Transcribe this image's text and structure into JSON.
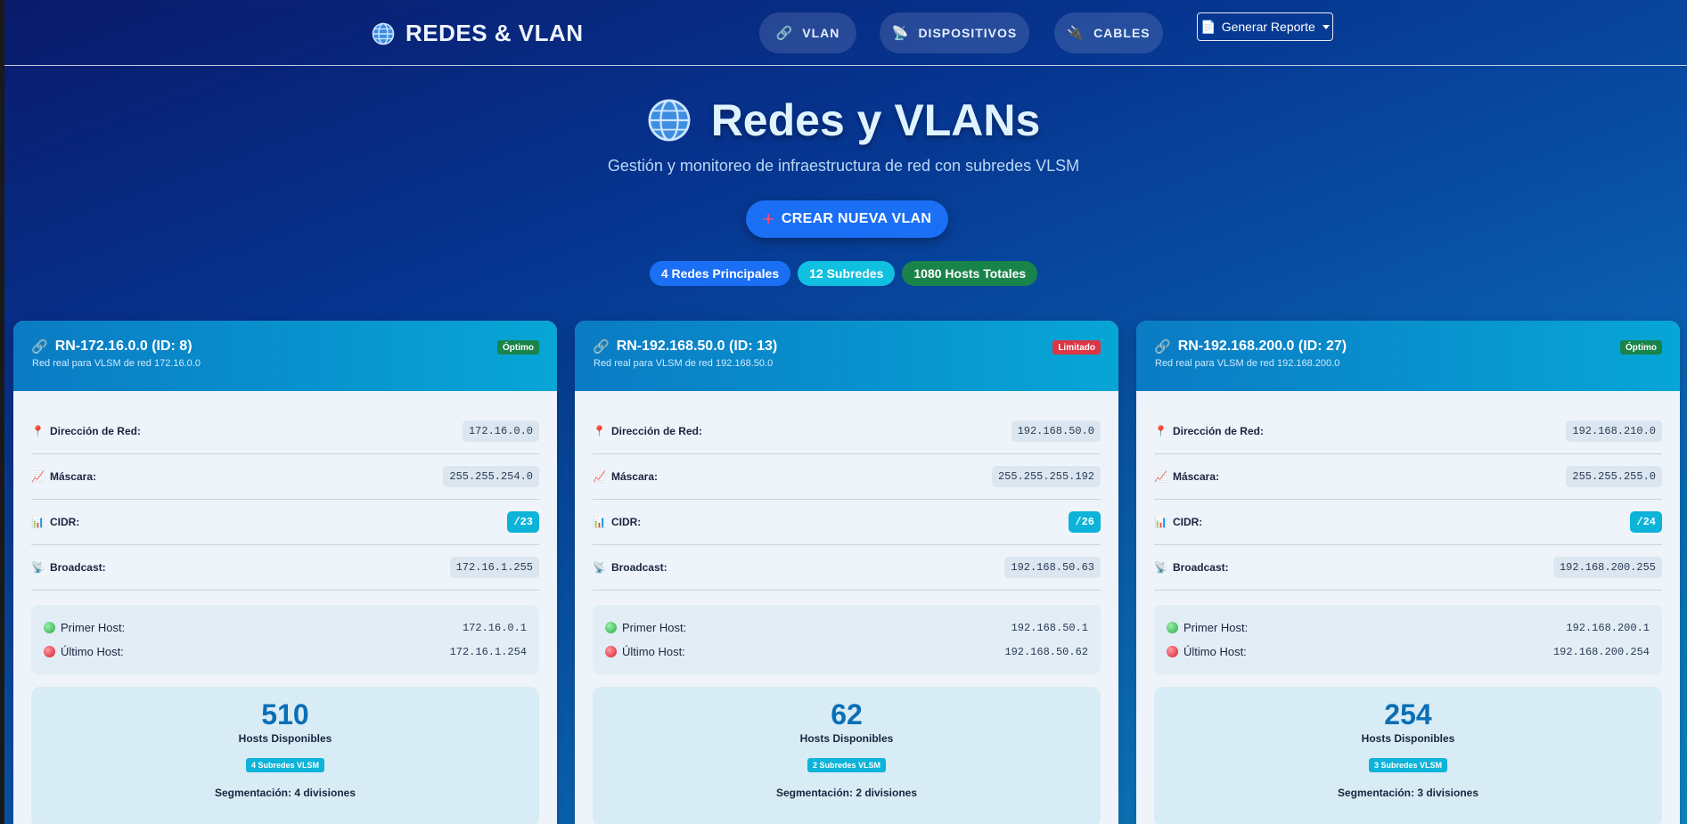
{
  "nav": {
    "brand": "REDES & VLAN",
    "links": [
      {
        "label": "VLAN",
        "icon": "link-icon"
      },
      {
        "label": "DISPOSITIVOS",
        "icon": "satellite-icon"
      },
      {
        "label": "CABLES",
        "icon": "cable-icon"
      }
    ],
    "report_label": "Generar Reporte"
  },
  "hero": {
    "title": "Redes y VLANs",
    "subtitle": "Gestión y monitoreo de infraestructura de red con subredes VLSM",
    "create_label": "CREAR NUEVA VLAN",
    "badges": [
      {
        "label": "4 Redes Principales",
        "color": "#1a6ff5"
      },
      {
        "label": "12 Subredes",
        "color": "#10c0e0"
      },
      {
        "label": "1080 Hosts Totales",
        "color": "#19844a"
      }
    ]
  },
  "labels": {
    "network": "Dirección de Red:",
    "mask": "Máscara:",
    "cidr": "CIDR:",
    "broadcast": "Broadcast:",
    "first_host": "Primer Host:",
    "last_host": "Último Host:",
    "hosts_available": "Hosts Disponibles"
  },
  "cards": [
    {
      "title": "RN-172.16.0.0 (ID: 8)",
      "description": "Red real para VLSM de red 172.16.0.0",
      "status": "Óptimo",
      "status_color": "#19844a",
      "network": "172.16.0.0",
      "mask": "255.255.254.0",
      "cidr": "/23",
      "broadcast": "172.16.1.255",
      "first_host": "172.16.0.1",
      "last_host": "172.16.1.254",
      "hosts": "510",
      "subnets_badge": "4 Subredes VLSM",
      "segmentation": "Segmentación: 4 divisiones"
    },
    {
      "title": "RN-192.168.50.0 (ID: 13)",
      "description": "Red real para VLSM de red 192.168.50.0",
      "status": "Limitado",
      "status_color": "#dc3545",
      "network": "192.168.50.0",
      "mask": "255.255.255.192",
      "cidr": "/26",
      "broadcast": "192.168.50.63",
      "first_host": "192.168.50.1",
      "last_host": "192.168.50.62",
      "hosts": "62",
      "subnets_badge": "2 Subredes VLSM",
      "segmentation": "Segmentación: 2 divisiones"
    },
    {
      "title": "RN-192.168.200.0 (ID: 27)",
      "description": "Red real para VLSM de red 192.168.200.0",
      "status": "Óptimo",
      "status_color": "#19844a",
      "network": "192.168.210.0",
      "mask": "255.255.255.0",
      "cidr": "/24",
      "broadcast": "192.168.200.255",
      "first_host": "192.168.200.1",
      "last_host": "192.168.200.254",
      "hosts": "254",
      "subnets_badge": "3 Subredes VLSM",
      "segmentation": "Segmentación: 3 divisiones"
    }
  ]
}
